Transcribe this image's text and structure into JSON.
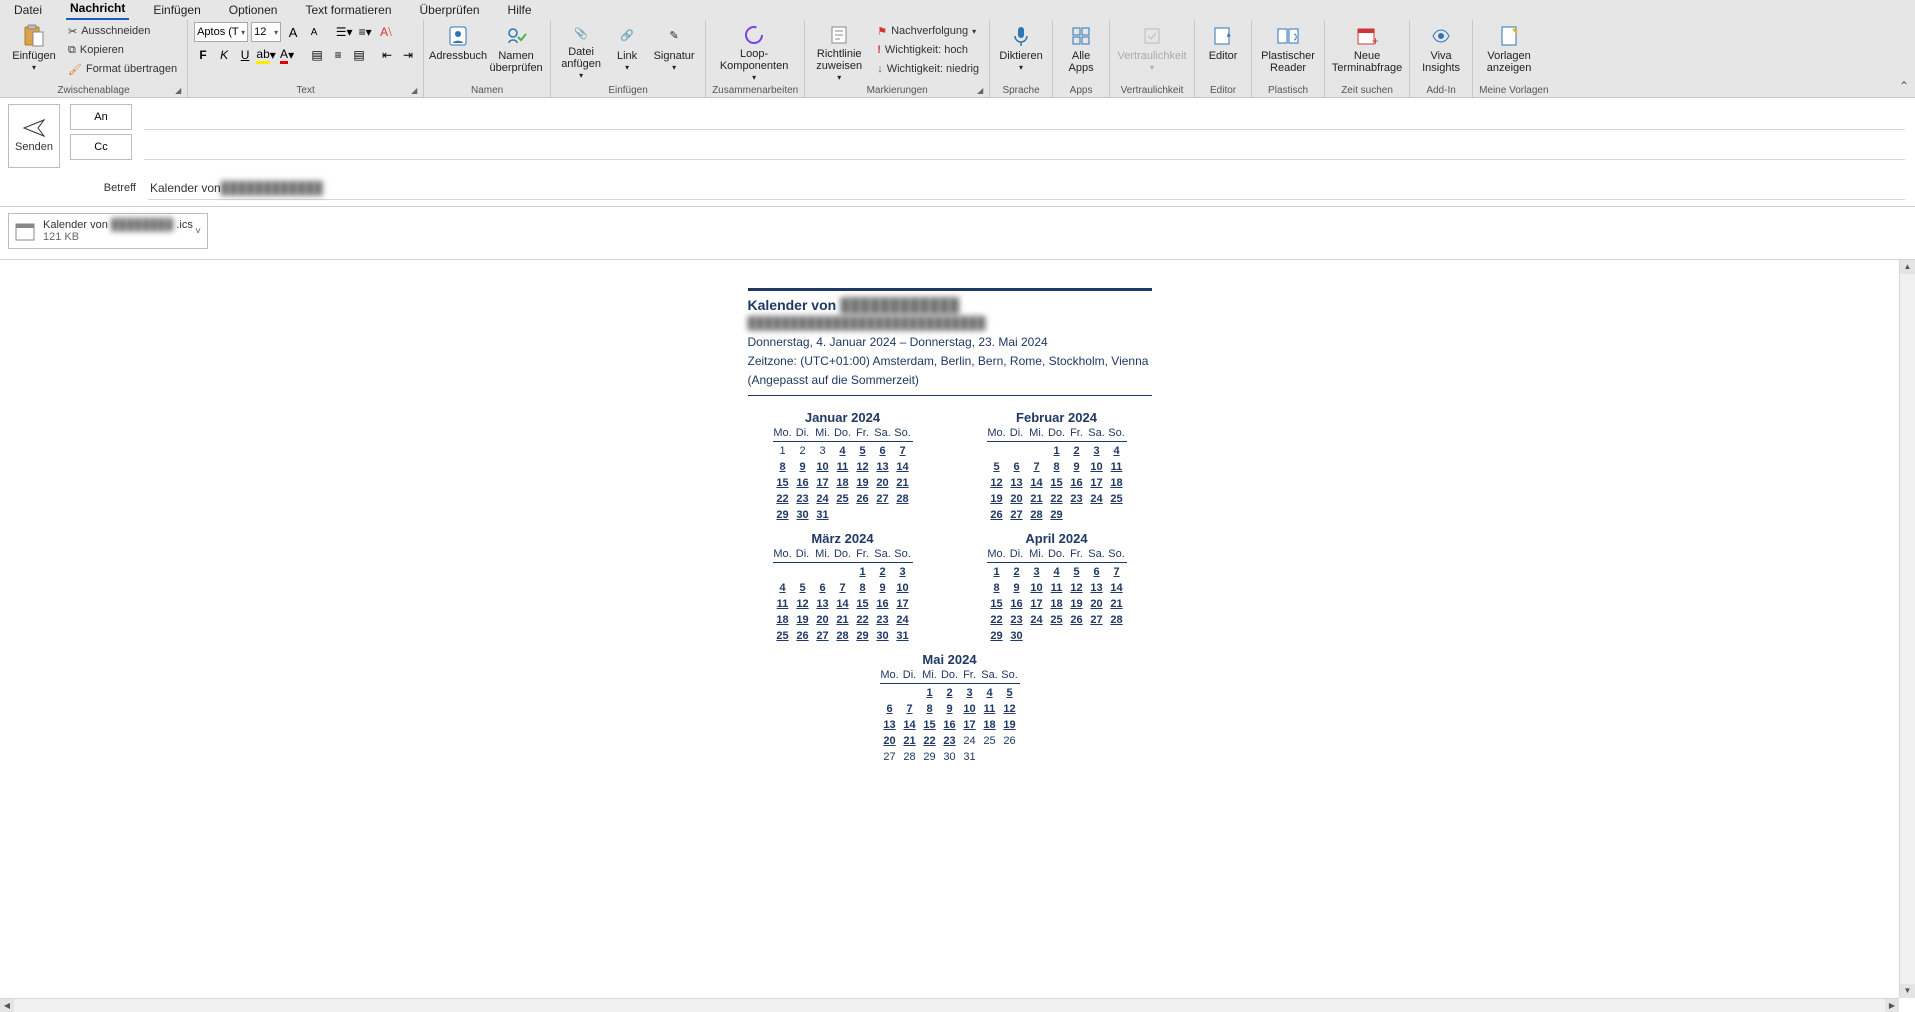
{
  "tabs": [
    "Datei",
    "Nachricht",
    "Einfügen",
    "Optionen",
    "Text formatieren",
    "Überprüfen",
    "Hilfe"
  ],
  "activeTab": 1,
  "ribbon": {
    "clipboard": {
      "paste": "Einfügen",
      "cut": "Ausschneiden",
      "copy": "Kopieren",
      "format": "Format übertragen",
      "label": "Zwischenablage"
    },
    "font": {
      "name": "Aptos (T",
      "size": "12",
      "bold": "F",
      "italic": "K",
      "underline": "U",
      "grow": "A",
      "shrink": "A",
      "clear": "Aₓ",
      "label": "Text"
    },
    "names": {
      "addressbook": "Adressbuch",
      "checknames": "Namen überprüfen",
      "label": "Namen"
    },
    "insert": {
      "attach": "Datei anfügen",
      "link": "Link",
      "signature": "Signatur",
      "label": "Einfügen"
    },
    "collab": {
      "loop": "Loop-Komponenten",
      "label": "Zusammenarbeiten"
    },
    "tags": {
      "policy": "Richtlinie zuweisen",
      "follow": "Nachverfolgung",
      "high": "Wichtigkeit: hoch",
      "low": "Wichtigkeit: niedrig",
      "label": "Markierungen"
    },
    "voice": {
      "dictate": "Diktieren",
      "label": "Sprache"
    },
    "apps": {
      "all": "Alle Apps",
      "label": "Apps"
    },
    "sens": {
      "btn": "Vertraulichkeit",
      "label": "Vertraulichkeit"
    },
    "editor": {
      "btn": "Editor",
      "label": "Editor"
    },
    "reader": {
      "btn": "Plastischer Reader",
      "label": "Plastisch"
    },
    "time": {
      "btn": "Neue Terminabfrage",
      "label": "Zeit suchen"
    },
    "viva": {
      "btn": "Viva Insights",
      "label": "Add-In"
    },
    "tpl": {
      "btn": "Vorlagen anzeigen",
      "label": "Meine Vorlagen"
    }
  },
  "compose": {
    "send": "Senden",
    "to": "An",
    "cc": "Cc",
    "subjectLabel": "Betreff",
    "subjectPrefix": "Kalender von ",
    "subjectBlur": "████████████"
  },
  "attachment": {
    "namePrefix": "Kalender von",
    "nameBlur": "████████",
    "nameSuffix": ".ics",
    "size": "121 KB"
  },
  "calendar": {
    "titlePrefix": "Kalender von",
    "titleBlur": "████████████",
    "line2": "████████████████████████████",
    "range": "Donnerstag, 4. Januar 2024 – Donnerstag, 23. Mai 2024",
    "tz": "Zeitzone: (UTC+01:00) Amsterdam, Berlin, Bern, Rome, Stockholm, Vienna",
    "dst": "(Angepasst auf die Sommerzeit)",
    "dow": [
      "Mo.",
      "Di.",
      "Mi.",
      "Do.",
      "Fr.",
      "Sa.",
      "So."
    ],
    "months": [
      {
        "name": "Januar 2024",
        "start": 0,
        "days": 31,
        "plainBefore": 4
      },
      {
        "name": "Februar 2024",
        "start": 3,
        "days": 29,
        "plainBefore": 0
      },
      {
        "name": "März 2024",
        "start": 4,
        "days": 31,
        "plainBefore": 0
      },
      {
        "name": "April 2024",
        "start": 0,
        "days": 30,
        "plainBefore": 0
      },
      {
        "name": "Mai 2024",
        "start": 2,
        "days": 31,
        "plainBefore": 0,
        "plainAfter": 24,
        "center": true
      }
    ]
  },
  "chart_data": {
    "type": "table",
    "title": "Kalender von … — Date range overview",
    "series": [
      {
        "name": "Januar 2024",
        "values": [
          1,
          2,
          3,
          4,
          5,
          6,
          7,
          8,
          9,
          10,
          11,
          12,
          13,
          14,
          15,
          16,
          17,
          18,
          19,
          20,
          21,
          22,
          23,
          24,
          25,
          26,
          27,
          28,
          29,
          30,
          31
        ],
        "first_weekday": "Mo"
      },
      {
        "name": "Februar 2024",
        "values": [
          1,
          2,
          3,
          4,
          5,
          6,
          7,
          8,
          9,
          10,
          11,
          12,
          13,
          14,
          15,
          16,
          17,
          18,
          19,
          20,
          21,
          22,
          23,
          24,
          25,
          26,
          27,
          28,
          29
        ],
        "first_weekday": "Do"
      },
      {
        "name": "März 2024",
        "values": [
          1,
          2,
          3,
          4,
          5,
          6,
          7,
          8,
          9,
          10,
          11,
          12,
          13,
          14,
          15,
          16,
          17,
          18,
          19,
          20,
          21,
          22,
          23,
          24,
          25,
          26,
          27,
          28,
          29,
          30,
          31
        ],
        "first_weekday": "Fr"
      },
      {
        "name": "April 2024",
        "values": [
          1,
          2,
          3,
          4,
          5,
          6,
          7,
          8,
          9,
          10,
          11,
          12,
          13,
          14,
          15,
          16,
          17,
          18,
          19,
          20,
          21,
          22,
          23,
          24,
          25,
          26,
          27,
          28,
          29,
          30
        ],
        "first_weekday": "Mo"
      },
      {
        "name": "Mai 2024",
        "values": [
          1,
          2,
          3,
          4,
          5,
          6,
          7,
          8,
          9,
          10,
          11,
          12,
          13,
          14,
          15,
          16,
          17,
          18,
          19,
          20,
          21,
          22,
          23,
          24,
          25,
          26,
          27,
          28,
          29,
          30,
          31
        ],
        "first_weekday": "Mi"
      }
    ],
    "highlight_range": {
      "from": "2024-01-04",
      "to": "2024-05-23"
    },
    "timezone": "(UTC+01:00) Amsterdam, Berlin, Bern, Rome, Stockholm, Vienna"
  }
}
